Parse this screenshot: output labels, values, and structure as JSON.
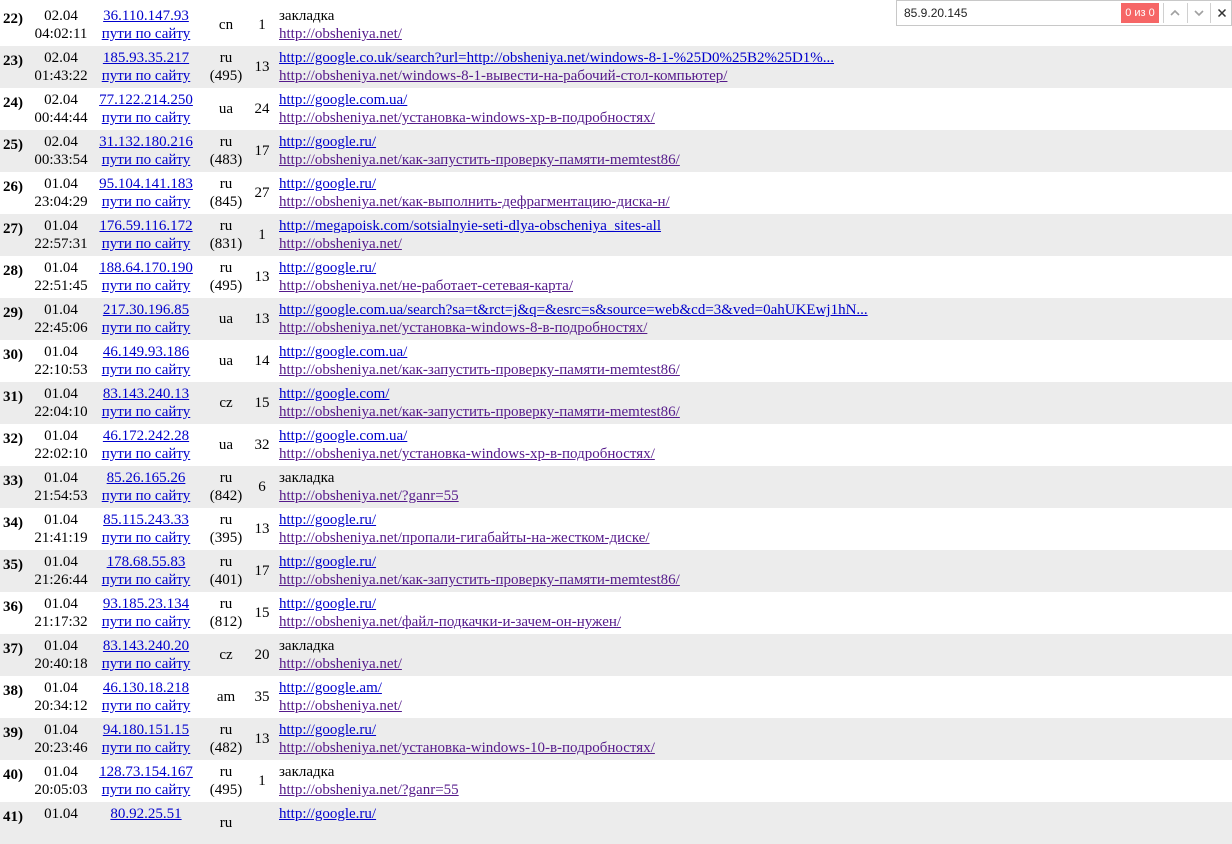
{
  "find_bar": {
    "query": "85.9.20.145",
    "match_count": "0 из 0",
    "prev_icon": "chevron-up-icon",
    "next_icon": "chevron-down-icon",
    "close_icon": "close-icon"
  },
  "colors": {
    "link": "#0000cc",
    "visited_link": "#551a8b",
    "row_alt": "#ececec",
    "find_no_match": "#f66666"
  },
  "rows": [
    {
      "num": "22)",
      "date": "02.04",
      "time": "04:02:11",
      "ip": "36.110.147.93",
      "path": "пути по сайту",
      "country": "cn",
      "code": "",
      "count": "1",
      "ref": "закладка",
      "ref_is_link": false,
      "page": "http://obsheniya.net/"
    },
    {
      "num": "23)",
      "date": "02.04",
      "time": "01:43:22",
      "ip": "185.93.35.217",
      "path": "пути по сайту",
      "country": "ru",
      "code": "(495)",
      "count": "13",
      "ref": "http://google.co.uk/search?url=http://obsheniya.net/windows-8-1-%25D0%25B2%25D1%...",
      "ref_is_link": true,
      "page": "http://obsheniya.net/windows-8-1-вывести-на-рабочий-стол-компьютер/"
    },
    {
      "num": "24)",
      "date": "02.04",
      "time": "00:44:44",
      "ip": "77.122.214.250",
      "path": "пути по сайту",
      "country": "ua",
      "code": "",
      "count": "24",
      "ref": "http://google.com.ua/",
      "ref_is_link": true,
      "page": "http://obsheniya.net/установка-windows-xp-в-подробностях/"
    },
    {
      "num": "25)",
      "date": "02.04",
      "time": "00:33:54",
      "ip": "31.132.180.216",
      "path": "пути по сайту",
      "country": "ru",
      "code": "(483)",
      "count": "17",
      "ref": "http://google.ru/",
      "ref_is_link": true,
      "page": "http://obsheniya.net/как-запустить-проверку-памяти-memtest86/"
    },
    {
      "num": "26)",
      "date": "01.04",
      "time": "23:04:29",
      "ip": "95.104.141.183",
      "path": "пути по сайту",
      "country": "ru",
      "code": "(845)",
      "count": "27",
      "ref": "http://google.ru/",
      "ref_is_link": true,
      "page": "http://obsheniya.net/как-выполнить-дефрагментацию-диска-н/"
    },
    {
      "num": "27)",
      "date": "01.04",
      "time": "22:57:31",
      "ip": "176.59.116.172",
      "path": "пути по сайту",
      "country": "ru",
      "code": "(831)",
      "count": "1",
      "ref": "http://megapoisk.com/sotsialnyie-seti-dlya-obscheniya_sites-all",
      "ref_is_link": true,
      "page": "http://obsheniya.net/"
    },
    {
      "num": "28)",
      "date": "01.04",
      "time": "22:51:45",
      "ip": "188.64.170.190",
      "path": "пути по сайту",
      "country": "ru",
      "code": "(495)",
      "count": "13",
      "ref": "http://google.ru/",
      "ref_is_link": true,
      "page": "http://obsheniya.net/не-работает-сетевая-карта/"
    },
    {
      "num": "29)",
      "date": "01.04",
      "time": "22:45:06",
      "ip": "217.30.196.85",
      "path": "пути по сайту",
      "country": "ua",
      "code": "",
      "count": "13",
      "ref": "http://google.com.ua/search?sa=t&rct=j&q=&esrc=s&source=web&cd=3&ved=0ahUKEwj1hN...",
      "ref_is_link": true,
      "page": "http://obsheniya.net/установка-windows-8-в-подробностях/"
    },
    {
      "num": "30)",
      "date": "01.04",
      "time": "22:10:53",
      "ip": "46.149.93.186",
      "path": "пути по сайту",
      "country": "ua",
      "code": "",
      "count": "14",
      "ref": "http://google.com.ua/",
      "ref_is_link": true,
      "page": "http://obsheniya.net/как-запустить-проверку-памяти-memtest86/"
    },
    {
      "num": "31)",
      "date": "01.04",
      "time": "22:04:10",
      "ip": "83.143.240.13",
      "path": "пути по сайту",
      "country": "cz",
      "code": "",
      "count": "15",
      "ref": "http://google.com/",
      "ref_is_link": true,
      "page": "http://obsheniya.net/как-запустить-проверку-памяти-memtest86/"
    },
    {
      "num": "32)",
      "date": "01.04",
      "time": "22:02:10",
      "ip": "46.172.242.28",
      "path": "пути по сайту",
      "country": "ua",
      "code": "",
      "count": "32",
      "ref": "http://google.com.ua/",
      "ref_is_link": true,
      "page": "http://obsheniya.net/установка-windows-xp-в-подробностях/"
    },
    {
      "num": "33)",
      "date": "01.04",
      "time": "21:54:53",
      "ip": "85.26.165.26",
      "path": "пути по сайту",
      "country": "ru",
      "code": "(842)",
      "count": "6",
      "ref": "закладка",
      "ref_is_link": false,
      "page": "http://obsheniya.net/?ganr=55"
    },
    {
      "num": "34)",
      "date": "01.04",
      "time": "21:41:19",
      "ip": "85.115.243.33",
      "path": "пути по сайту",
      "country": "ru",
      "code": "(395)",
      "count": "13",
      "ref": "http://google.ru/",
      "ref_is_link": true,
      "page": "http://obsheniya.net/пропали-гигабайты-на-жестком-диске/"
    },
    {
      "num": "35)",
      "date": "01.04",
      "time": "21:26:44",
      "ip": "178.68.55.83",
      "path": "пути по сайту",
      "country": "ru",
      "code": "(401)",
      "count": "17",
      "ref": "http://google.ru/",
      "ref_is_link": true,
      "page": "http://obsheniya.net/как-запустить-проверку-памяти-memtest86/"
    },
    {
      "num": "36)",
      "date": "01.04",
      "time": "21:17:32",
      "ip": "93.185.23.134",
      "path": "пути по сайту",
      "country": "ru",
      "code": "(812)",
      "count": "15",
      "ref": "http://google.ru/",
      "ref_is_link": true,
      "page": "http://obsheniya.net/файл-подкачки-и-зачем-он-нужен/"
    },
    {
      "num": "37)",
      "date": "01.04",
      "time": "20:40:18",
      "ip": "83.143.240.20",
      "path": "пути по сайту",
      "country": "cz",
      "code": "",
      "count": "20",
      "ref": "закладка",
      "ref_is_link": false,
      "page": "http://obsheniya.net/"
    },
    {
      "num": "38)",
      "date": "01.04",
      "time": "20:34:12",
      "ip": "46.130.18.218",
      "path": "пути по сайту",
      "country": "am",
      "code": "",
      "count": "35",
      "ref": "http://google.am/",
      "ref_is_link": true,
      "page": "http://obsheniya.net/"
    },
    {
      "num": "39)",
      "date": "01.04",
      "time": "20:23:46",
      "ip": "94.180.151.15",
      "path": "пути по сайту",
      "country": "ru",
      "code": "(482)",
      "count": "13",
      "ref": "http://google.ru/",
      "ref_is_link": true,
      "page": "http://obsheniya.net/установка-windows-10-в-подробностях/"
    },
    {
      "num": "40)",
      "date": "01.04",
      "time": "20:05:03",
      "ip": "128.73.154.167",
      "path": "пути по сайту",
      "country": "ru",
      "code": "(495)",
      "count": "1",
      "ref": "закладка",
      "ref_is_link": false,
      "page": "http://obsheniya.net/?ganr=55"
    },
    {
      "num": "41)",
      "date": "01.04",
      "time": "",
      "ip": "80.92.25.51",
      "path": "",
      "country": "ru",
      "code": "",
      "count": "",
      "ref": "http://google.ru/",
      "ref_is_link": true,
      "page": ""
    }
  ]
}
